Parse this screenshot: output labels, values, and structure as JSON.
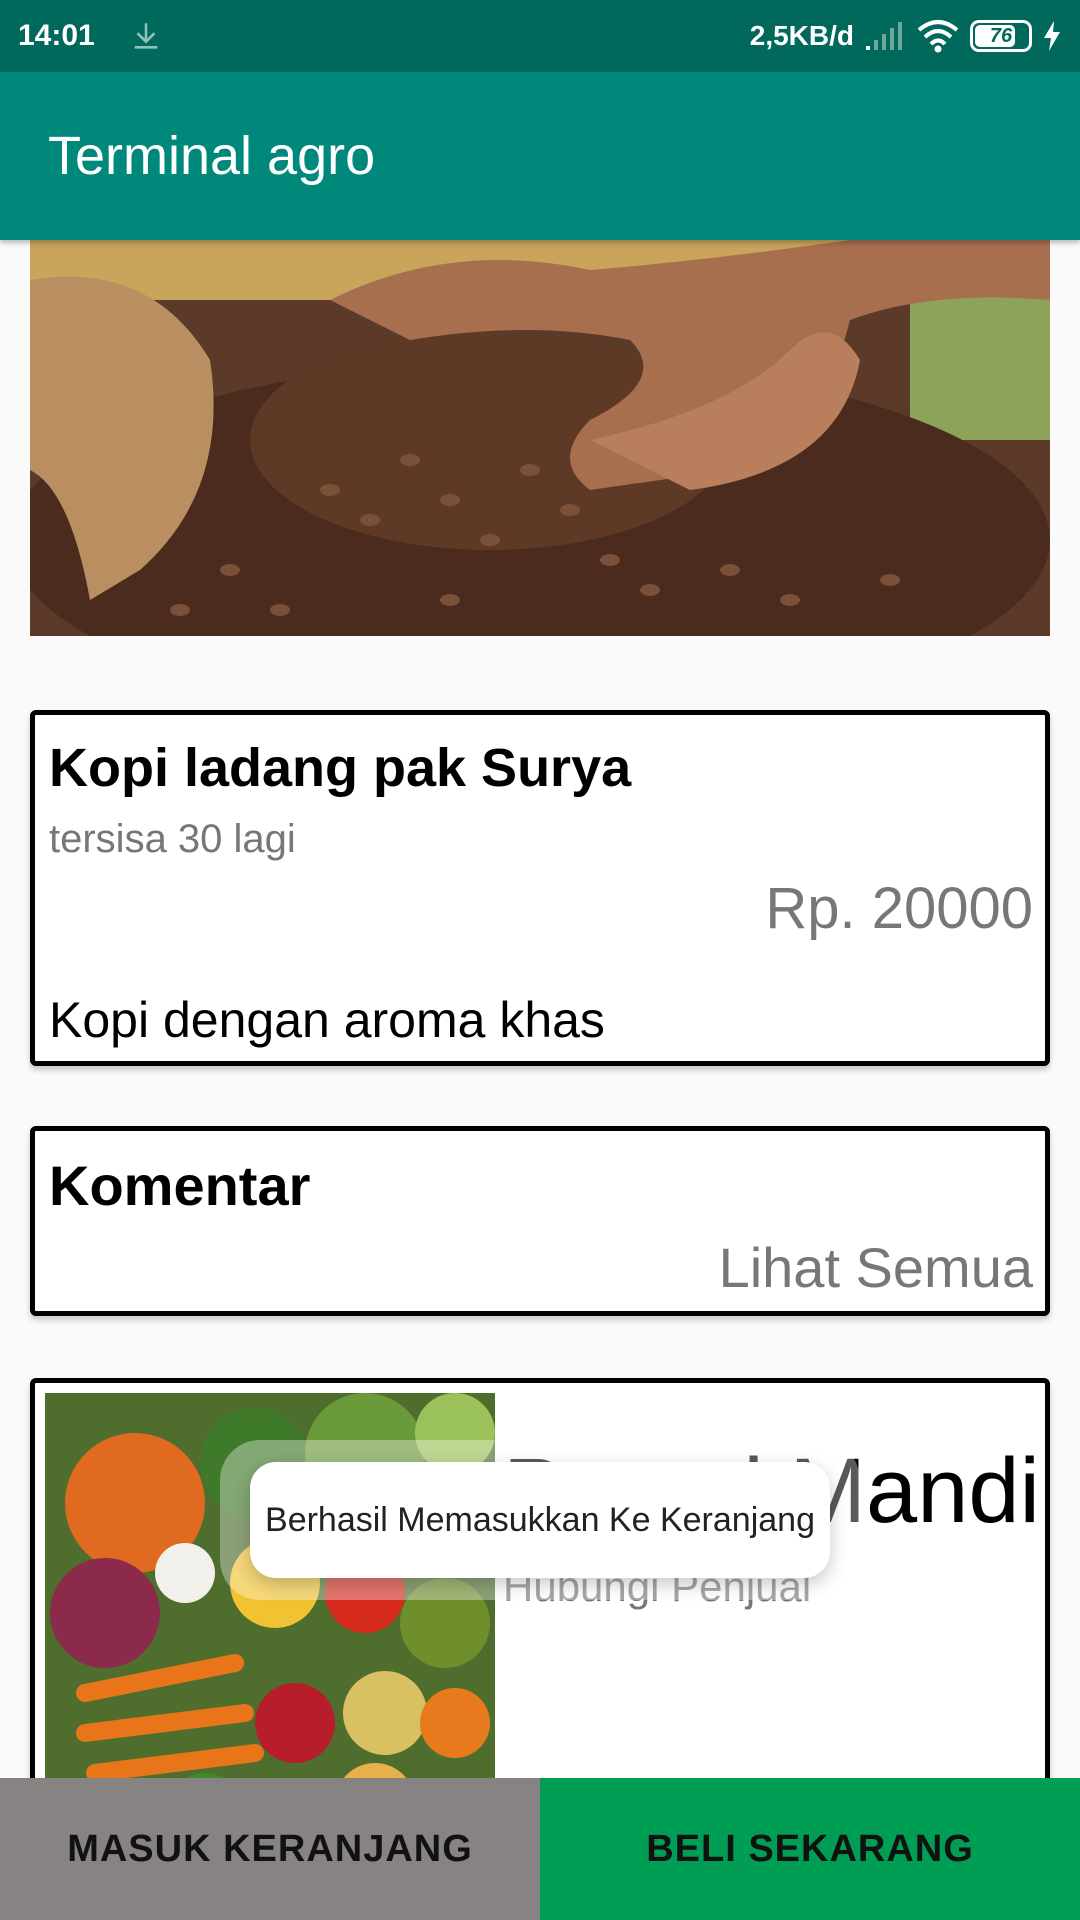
{
  "status_bar": {
    "time": "14:01",
    "net_speed": "2,5KB/d",
    "battery": "76",
    "icons": [
      "download-icon",
      "signal-icon",
      "wifi-icon",
      "battery-icon",
      "charging-icon"
    ]
  },
  "app_bar": {
    "title": "Terminal agro"
  },
  "product": {
    "name": "Kopi ladang pak Surya",
    "stock": "tersisa 30 lagi",
    "price": "Rp. 20000",
    "description": "Kopi dengan aroma khas"
  },
  "comments": {
    "title": "Komentar",
    "see_all": "Lihat Semua"
  },
  "seller": {
    "name": "Petani Mandiri",
    "contact": "Hubungi Penjual"
  },
  "toast": {
    "message": "Berhasil Memasukkan Ke Keranjang"
  },
  "actions": {
    "add_to_cart": "MASUK KERANJANG",
    "buy_now": "BELI SEKARANG"
  },
  "colors": {
    "status_bar": "#00695c",
    "app_bar": "#00897b",
    "cart_button": "#888383",
    "buy_button": "#009e55"
  }
}
